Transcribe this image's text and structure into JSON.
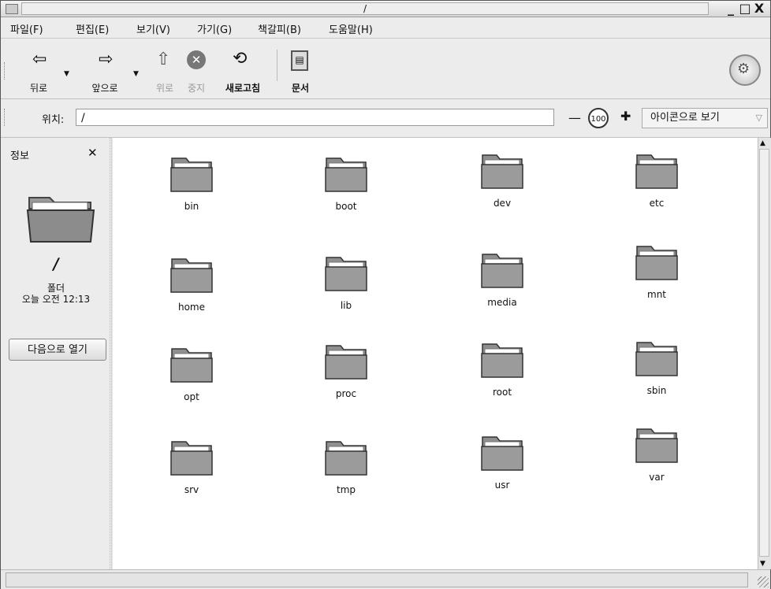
{
  "window": {
    "title": "/"
  },
  "window_controls": [
    "_",
    "□",
    "X"
  ],
  "menu": [
    "파일(F)",
    "편집(E)",
    "보기(V)",
    "가기(G)",
    "책갈피(B)",
    "도움말(H)"
  ],
  "toolbar": {
    "back": "뒤로",
    "forward": "앞으로",
    "up": "위로",
    "stop": "중지",
    "reload": "새로고침",
    "documents": "문서"
  },
  "location": {
    "label": "위치:",
    "value": "/",
    "zoom": "100",
    "view_mode": "아이콘으로 보기"
  },
  "sidebar": {
    "title": "정보",
    "name": "/",
    "type": "폴더",
    "modified": "오늘 오전 12:13",
    "open_with": "다음으로 열기"
  },
  "folders": [
    {
      "name": "bin"
    },
    {
      "name": "boot"
    },
    {
      "name": "dev"
    },
    {
      "name": "etc"
    },
    {
      "name": "home"
    },
    {
      "name": "lib"
    },
    {
      "name": "media"
    },
    {
      "name": "mnt"
    },
    {
      "name": "opt"
    },
    {
      "name": "proc"
    },
    {
      "name": "root"
    },
    {
      "name": "sbin"
    },
    {
      "name": "srv"
    },
    {
      "name": "tmp"
    },
    {
      "name": "usr"
    },
    {
      "name": "var"
    }
  ],
  "status": {
    "text": ""
  }
}
